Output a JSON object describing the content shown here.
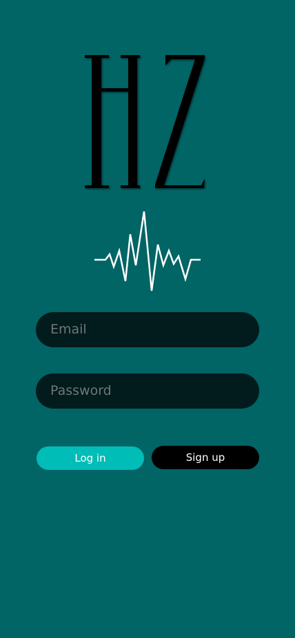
{
  "logo": {
    "text": "HZ",
    "icon": "heartbeat-pulse-icon"
  },
  "form": {
    "email_placeholder": "Email",
    "password_placeholder": "Password"
  },
  "buttons": {
    "login": "Log in",
    "signup": "Sign up"
  },
  "colors": {
    "background": "#016465",
    "input": "#021b1c",
    "login": "#00bdb8",
    "signup": "#000000"
  }
}
